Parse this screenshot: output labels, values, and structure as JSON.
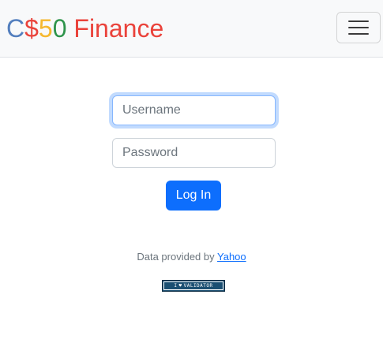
{
  "navbar": {
    "brand": {
      "parts": [
        {
          "text": "C",
          "color": "#537fbe"
        },
        {
          "text": "$",
          "color": "#ea433b"
        },
        {
          "text": "5",
          "color": "#f5b82e"
        },
        {
          "text": "0",
          "color": "#2e944b"
        },
        {
          "text": " Finance",
          "color": "#ea433b"
        }
      ]
    },
    "toggler_icon": "hamburger-menu-icon"
  },
  "login_form": {
    "username_placeholder": "Username",
    "password_placeholder": "Password",
    "submit_label": "Log In"
  },
  "footer": {
    "prefix": "Data provided by ",
    "link_label": "Yahoo",
    "validator_badge": {
      "left": "I",
      "icon": "heart-icon",
      "right": "VALIDATOR"
    }
  },
  "colors": {
    "primary": "#0d6efd",
    "navbar_bg": "#f8f9fa"
  }
}
